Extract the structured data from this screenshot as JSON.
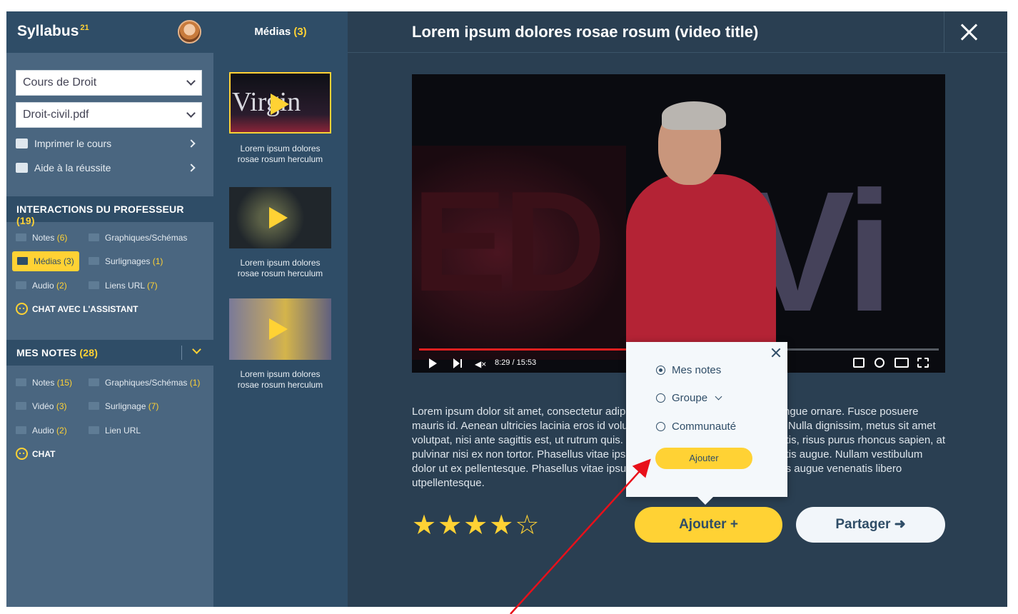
{
  "brand": {
    "name": "Syllabus",
    "sup": "21"
  },
  "sidebar": {
    "course_select": "Cours de Droit",
    "file_select": "Droit-civil.pdf",
    "links": [
      {
        "label": "Imprimer le cours",
        "icon": "printer-icon"
      },
      {
        "label": "Aide à la réussite",
        "icon": "graduation-cap-icon"
      }
    ],
    "prof_section": {
      "title": "INTERACTIONS DU PROFESSEUR",
      "count": "(19)"
    },
    "prof_items": [
      {
        "label": "Notes",
        "count": "(6)"
      },
      {
        "label": "Graphiques/Schémas",
        "count": ""
      },
      {
        "label": "Médias",
        "count": "(3)"
      },
      {
        "label": "Surlignages",
        "count": "(1)"
      },
      {
        "label": "Audio",
        "count": "(2)"
      },
      {
        "label": "Liens URL",
        "count": "(7)"
      }
    ],
    "prof_chat": "CHAT AVEC L'ASSISTANT",
    "notes_section": {
      "title": "MES NOTES",
      "count": "(28)"
    },
    "notes_items": [
      {
        "label": "Notes",
        "count": "(15)"
      },
      {
        "label": "Graphiques/Schémas",
        "count": "(1)"
      },
      {
        "label": "Vidéo",
        "count": "(3)"
      },
      {
        "label": "Surlignage",
        "count": "(7)"
      },
      {
        "label": "Audio",
        "count": "(2)"
      },
      {
        "label": "Lien URL",
        "count": ""
      }
    ],
    "notes_chat": "CHAT"
  },
  "media": {
    "title": "Médias",
    "count": "(3)",
    "thumb_label": "Virgin",
    "items": [
      {
        "caption_line1": "Lorem ipsum dolores",
        "caption_line2": "rosae rosum herculum"
      },
      {
        "caption_line1": "Lorem ipsum dolores",
        "caption_line2": "rosae rosum herculum"
      },
      {
        "caption_line1": "Lorem ipsum dolores",
        "caption_line2": "rosae rosum herculum"
      }
    ]
  },
  "main": {
    "title": "Lorem ipsum dolores rosae rosum (video title)",
    "video": {
      "time": "8:29 / 15:53",
      "progress": 0.41,
      "stage_left": "ED",
      "stage_right": "Vi"
    },
    "description": "Lorem ipsum dolor sit amet, consectetur adipiscing elit. Fusce varius nisl ac congue ornare. Fusce posuere mauris id. Aenean ultricies lacinia eros id volutpat. In molestie tristique semper. Nulla dignissim, metus sit amet volutpat, nisi ante sagittis est, ut rutrum quis. Duis feugiat, odio vitae mollis mattis, risus purus rhoncus sapien, at pulvinar nisi ex non tortor. Phasellus vitae ipsum tincidunt, varius tortor in, sagittis augue. Nullam vestibulum dolor ut ex pellentesque. Phasellus vitae ipsum tincidunt, varius tortor in, sagittis augue venenatis libero utpellentesque.",
    "rating": {
      "value": 4,
      "max": 5
    },
    "add_button": "Ajouter +",
    "share_button": "Partager ➜"
  },
  "popup": {
    "options": [
      {
        "label": "Mes notes",
        "selected": true
      },
      {
        "label": "Groupe",
        "selected": false
      },
      {
        "label": "Communauté",
        "selected": false
      }
    ],
    "add_button": "Ajouter"
  },
  "colors": {
    "accent": "#ffd234",
    "sidebar": "#4a6680",
    "dark": "#2f4d67",
    "main_bg": "#2a3f52",
    "annotation": "#e8101a"
  }
}
